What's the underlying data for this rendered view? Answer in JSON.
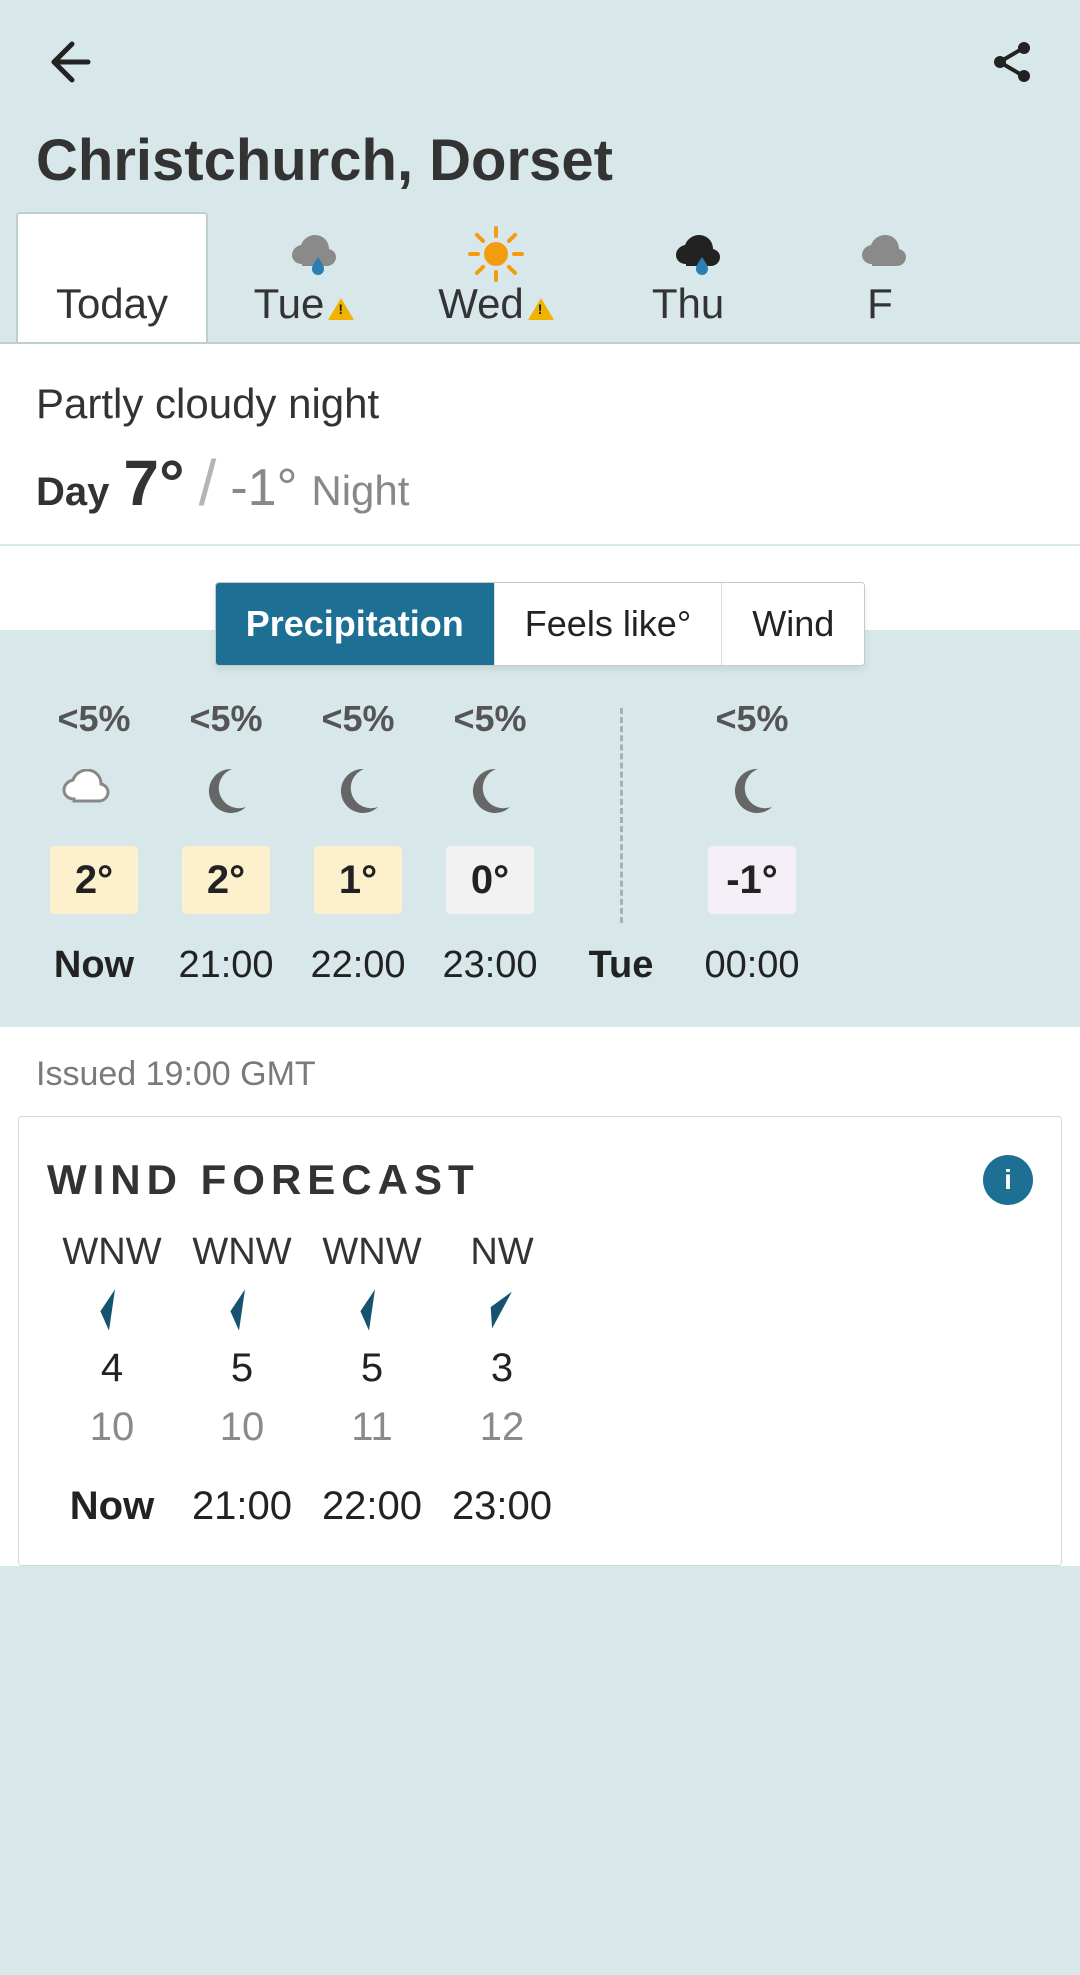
{
  "location": "Christchurch, Dorset",
  "day_tabs": [
    {
      "label": "Today",
      "weather": "none",
      "warn": false,
      "active": true
    },
    {
      "label": "Tue",
      "weather": "rain-cloud",
      "warn": true,
      "active": false
    },
    {
      "label": "Wed",
      "weather": "sunny",
      "warn": true,
      "active": false
    },
    {
      "label": "Thu",
      "weather": "dark-rain",
      "warn": false,
      "active": false
    },
    {
      "label": "F",
      "weather": "cloud",
      "warn": false,
      "active": false
    }
  ],
  "summary": {
    "condition": "Partly cloudy night",
    "day_label": "Day",
    "day_temp": "7°",
    "night_temp": "-1°",
    "night_label": "Night"
  },
  "segments": [
    "Precipitation",
    "Feels like°",
    "Wind"
  ],
  "active_segment": 0,
  "hourly": [
    {
      "precip": "<5%",
      "icon": "cloud",
      "temp": "2°",
      "temp_cls": "tc-warm",
      "time": "Now",
      "bold": true
    },
    {
      "precip": "<5%",
      "icon": "moon",
      "temp": "2°",
      "temp_cls": "tc-warm",
      "time": "21:00"
    },
    {
      "precip": "<5%",
      "icon": "moon",
      "temp": "1°",
      "temp_cls": "tc-warm",
      "time": "22:00"
    },
    {
      "precip": "<5%",
      "icon": "moon",
      "temp": "0°",
      "temp_cls": "tc-cool",
      "time": "23:00"
    }
  ],
  "next_day_label": "Tue",
  "hourly_next": [
    {
      "precip": "<5%",
      "icon": "moon",
      "temp": "-1°",
      "temp_cls": "tc-cold",
      "time": "00:00"
    }
  ],
  "issued": "Issued 19:00 GMT",
  "wind": {
    "title": "WIND FORECAST",
    "cols": [
      {
        "dir": "WNW",
        "rot": 115,
        "speed": "4",
        "gust": "10",
        "time": "Now",
        "bold": true
      },
      {
        "dir": "WNW",
        "rot": 115,
        "speed": "5",
        "gust": "10",
        "time": "21:00"
      },
      {
        "dir": "WNW",
        "rot": 115,
        "speed": "5",
        "gust": "11",
        "time": "22:00"
      },
      {
        "dir": "NW",
        "rot": 135,
        "speed": "3",
        "gust": "12",
        "time": "23:00"
      }
    ]
  }
}
